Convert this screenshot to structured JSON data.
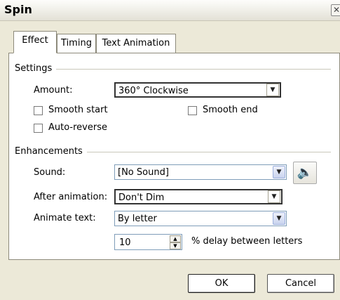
{
  "window": {
    "title": "Spin",
    "close_glyph": "✕"
  },
  "tabs": [
    {
      "label": "Effect",
      "active": true
    },
    {
      "label": "Timing",
      "active": false
    },
    {
      "label": "Text Animation",
      "active": false
    }
  ],
  "settings": {
    "group_label": "Settings",
    "amount_label": "Amount:",
    "amount_value": "360° Clockwise",
    "smooth_start_label": "Smooth start",
    "smooth_start_checked": false,
    "smooth_end_label": "Smooth end",
    "smooth_end_checked": false,
    "auto_reverse_label": "Auto-reverse",
    "auto_reverse_checked": false
  },
  "enhancements": {
    "group_label": "Enhancements",
    "sound_label": "Sound:",
    "sound_value": "[No Sound]",
    "after_animation_label": "After animation:",
    "after_animation_value": "Don't Dim",
    "animate_text_label": "Animate text:",
    "animate_text_value": "By letter",
    "delay_value": "10",
    "delay_suffix": "% delay between letters"
  },
  "buttons": {
    "ok": "OK",
    "cancel": "Cancel"
  },
  "icons": {
    "dropdown": "▼",
    "spin_up": "▲",
    "spin_down": "▼",
    "speaker": "🔈"
  }
}
